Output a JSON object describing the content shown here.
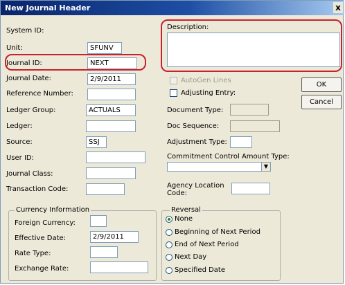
{
  "window": {
    "title": "New Journal Header",
    "close_glyph": "x"
  },
  "fields": {
    "system_id": {
      "label": "System ID:"
    },
    "unit": {
      "label": "Unit:",
      "value": "SFUNV"
    },
    "journal_id": {
      "label": "Journal ID:",
      "value": "NEXT"
    },
    "journal_date": {
      "label": "Journal Date:",
      "value": "2/9/2011"
    },
    "reference_number": {
      "label": "Reference Number:",
      "value": ""
    },
    "ledger_group": {
      "label": "Ledger Group:",
      "value": "ACTUALS"
    },
    "ledger": {
      "label": "Ledger:",
      "value": ""
    },
    "source": {
      "label": "Source:",
      "value": "SSJ"
    },
    "user_id": {
      "label": "User ID:",
      "value": ""
    },
    "journal_class": {
      "label": "Journal Class:",
      "value": ""
    },
    "transaction_code": {
      "label": "Transaction Code:",
      "value": ""
    },
    "description": {
      "label": "Description:",
      "value": ""
    },
    "autogen_lines": {
      "label": "AutoGen Lines"
    },
    "adjusting_entry": {
      "label": "Adjusting Entry:"
    },
    "document_type": {
      "label": "Document Type:"
    },
    "doc_sequence": {
      "label": "Doc Sequence:"
    },
    "adjustment_type": {
      "label": "Adjustment Type:"
    },
    "commitment_control": {
      "label": "Commitment Control Amount Type:",
      "value": ""
    },
    "agency_location": {
      "label_line1": "Agency Location",
      "label_line2": "Code:"
    }
  },
  "buttons": {
    "ok": "OK",
    "cancel": "Cancel"
  },
  "currency": {
    "title": "Currency Information",
    "foreign_currency": {
      "label": "Foreign Currency:",
      "value": ""
    },
    "effective_date": {
      "label": "Effective Date:",
      "value": "2/9/2011"
    },
    "rate_type": {
      "label": "Rate Type:",
      "value": ""
    },
    "exchange_rate": {
      "label": "Exchange Rate:",
      "value": ""
    }
  },
  "reversal": {
    "title": "Reversal",
    "options": [
      {
        "label": "None",
        "checked": true
      },
      {
        "label": "Beginning of Next Period",
        "checked": false
      },
      {
        "label": "End of Next Period",
        "checked": false
      },
      {
        "label": "Next Day",
        "checked": false
      },
      {
        "label": "Specified Date",
        "checked": false
      }
    ]
  },
  "colors": {
    "highlight": "#c8202f",
    "title_bar": "#0a246a",
    "dialog_bg": "#ece9d8"
  }
}
